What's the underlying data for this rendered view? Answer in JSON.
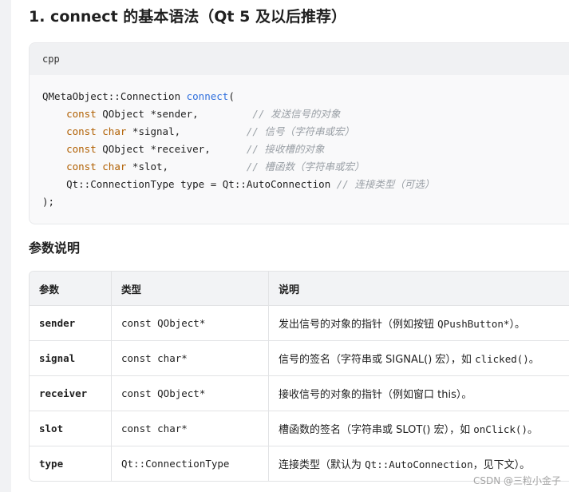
{
  "heading": "1. connect 的基本语法（Qt 5 及以后推荐）",
  "code": {
    "language": "cpp",
    "lines": [
      [
        {
          "t": "QMetaObject::Connection ",
          "c": ""
        },
        {
          "t": "connect",
          "c": "fn"
        },
        {
          "t": "(",
          "c": ""
        }
      ],
      [
        {
          "t": "    ",
          "c": ""
        },
        {
          "t": "const",
          "c": "kw"
        },
        {
          "t": " QObject *sender,         ",
          "c": ""
        },
        {
          "t": "// 发送信号的对象",
          "c": "cm"
        }
      ],
      [
        {
          "t": "    ",
          "c": ""
        },
        {
          "t": "const",
          "c": "kw"
        },
        {
          "t": " ",
          "c": ""
        },
        {
          "t": "char",
          "c": "kw"
        },
        {
          "t": " *signal,           ",
          "c": ""
        },
        {
          "t": "// 信号（字符串或宏）",
          "c": "cm"
        }
      ],
      [
        {
          "t": "    ",
          "c": ""
        },
        {
          "t": "const",
          "c": "kw"
        },
        {
          "t": " QObject *receiver,      ",
          "c": ""
        },
        {
          "t": "// 接收槽的对象",
          "c": "cm"
        }
      ],
      [
        {
          "t": "    ",
          "c": ""
        },
        {
          "t": "const",
          "c": "kw"
        },
        {
          "t": " ",
          "c": ""
        },
        {
          "t": "char",
          "c": "kw"
        },
        {
          "t": " *slot,             ",
          "c": ""
        },
        {
          "t": "// 槽函数（字符串或宏）",
          "c": "cm"
        }
      ],
      [
        {
          "t": "    Qt::ConnectionType type = Qt::AutoConnection ",
          "c": ""
        },
        {
          "t": "// 连接类型（可选）",
          "c": "cm"
        }
      ],
      [
        {
          "t": ");",
          "c": ""
        }
      ]
    ]
  },
  "section_title": "参数说明",
  "table": {
    "headers": {
      "param": "参数",
      "type": "类型",
      "desc": "说明"
    },
    "rows": [
      {
        "param": "sender",
        "type": "const QObject*",
        "desc": [
          {
            "t": "发出信号的对象的指针（例如按钮 ",
            "m": false
          },
          {
            "t": "QPushButton*",
            "m": true
          },
          {
            "t": "）。",
            "m": false
          }
        ]
      },
      {
        "param": "signal",
        "type": "const char*",
        "desc": [
          {
            "t": "信号的签名（字符串或 SIGNAL() 宏），如 ",
            "m": false
          },
          {
            "t": "clicked()",
            "m": true
          },
          {
            "t": "。",
            "m": false
          }
        ]
      },
      {
        "param": "receiver",
        "type": "const QObject*",
        "desc": [
          {
            "t": "接收信号的对象的指针（例如窗口 this）。",
            "m": false
          }
        ]
      },
      {
        "param": "slot",
        "type": "const char*",
        "desc": [
          {
            "t": "槽函数的签名（字符串或 SLOT() 宏），如 ",
            "m": false
          },
          {
            "t": "onClick()",
            "m": true
          },
          {
            "t": "。",
            "m": false
          }
        ]
      },
      {
        "param": "type",
        "type": "Qt::ConnectionType",
        "desc": [
          {
            "t": "连接类型（默认为 ",
            "m": false
          },
          {
            "t": "Qt::AutoConnection",
            "m": true
          },
          {
            "t": "，见下文）。",
            "m": false
          }
        ]
      }
    ]
  },
  "watermark": "CSDN @三粒小金子"
}
